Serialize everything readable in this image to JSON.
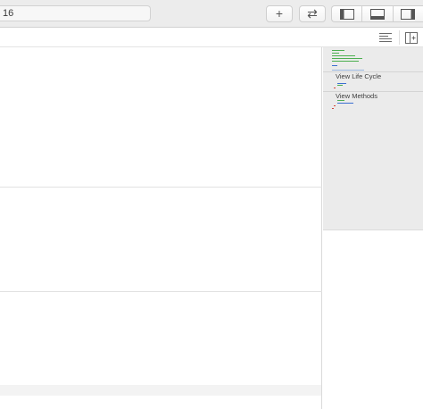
{
  "toolbar": {
    "activity_text": "16",
    "add_symbol": "+",
    "swap_symbol": "⇄",
    "panels": [
      "navigator-panel-toggle",
      "debug-panel-toggle",
      "inspector-panel-toggle"
    ]
  },
  "minimap": {
    "marks": [
      {
        "label": "View Life Cycle"
      },
      {
        "label": "View Methods"
      }
    ]
  },
  "colors": {
    "toolbar_bg": "#ececec",
    "minimap_bg": "#ebebeb",
    "code_green": "#4caf50",
    "code_blue": "#3b6fd1",
    "code_red": "#d0453b"
  }
}
